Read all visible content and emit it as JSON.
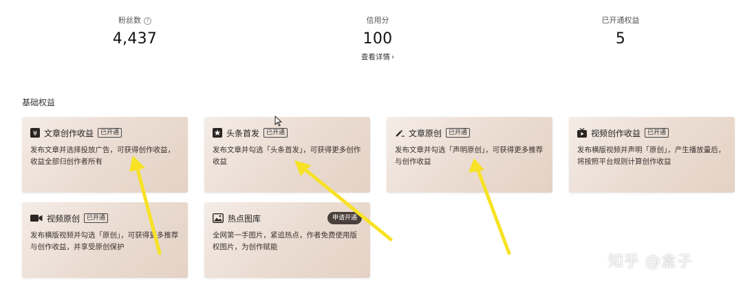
{
  "stats": [
    {
      "label": "粉丝数",
      "value": "4,437",
      "has_help": true
    },
    {
      "label": "信用分",
      "value": "100",
      "link": "查看详情"
    },
    {
      "label": "已开通权益",
      "value": "5"
    }
  ],
  "section_title": "基础权益",
  "cards": [
    {
      "icon": "yen-icon",
      "title": "文章创作收益",
      "badge": "已开通",
      "desc": "发布文章并选择投放广告，可获得创作收益，收益全部归创作者所有"
    },
    {
      "icon": "star-icon",
      "title": "头条首发",
      "badge": "已开通",
      "desc": "发布文章并勾选「头条首发」，可获得更多创作收益"
    },
    {
      "icon": "pen-icon",
      "title": "文章原创",
      "badge": "已开通",
      "desc": "发布文章并勾选「声明原创」，可获得更多推荐与创作收益"
    },
    {
      "icon": "tv-icon",
      "title": "视频创作收益",
      "badge": "已开通",
      "desc": "发布横版视频并声明「原创」，产生播放量后，将按照平台规则计算创作收益"
    },
    {
      "icon": "video-camera-icon",
      "title": "视频原创",
      "badge": "已开通",
      "desc": "发布横版视频并勾选「原创」，可获得更多推荐与创作收益，并享受原创保护"
    },
    {
      "icon": "image-icon",
      "title": "热点图库",
      "button": "申请开通",
      "desc": "全网第一手图片，紧追热点，作者免费使用版权图片，为创作赋能"
    }
  ],
  "watermark": "知乎 @盒子",
  "colors": {
    "card_bg_start": "#f4ece6",
    "card_bg_end": "#e4d2c5",
    "arrow": "#f7e225",
    "apply_button": "#4a3f3a"
  }
}
